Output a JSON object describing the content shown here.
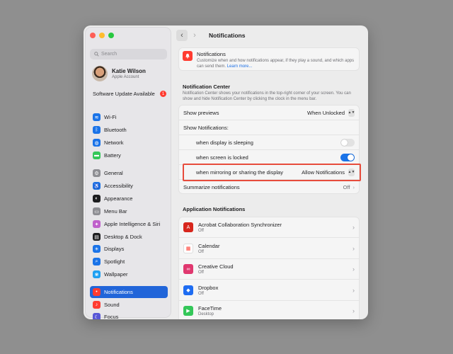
{
  "window": {
    "title": "Notifications"
  },
  "sidebar": {
    "search_placeholder": "Search",
    "account": {
      "name": "Katie Wilson",
      "subtitle": "Apple Account"
    },
    "update": {
      "label": "Software Update Available",
      "count": "1"
    },
    "items": [
      {
        "label": "Wi-Fi",
        "icon": "wifi-icon",
        "color": "#1a73e8"
      },
      {
        "label": "Bluetooth",
        "icon": "bluetooth-icon",
        "color": "#1a73e8"
      },
      {
        "label": "Network",
        "icon": "globe-icon",
        "color": "#1a73e8"
      },
      {
        "label": "Battery",
        "icon": "battery-icon",
        "color": "#34c759"
      },
      {
        "label": "General",
        "icon": "gear-icon",
        "color": "#8e8e93"
      },
      {
        "label": "Accessibility",
        "icon": "accessibility-icon",
        "color": "#1a73e8"
      },
      {
        "label": "Appearance",
        "icon": "appearance-icon",
        "color": "#1d1d1f"
      },
      {
        "label": "Menu Bar",
        "icon": "menubar-icon",
        "color": "#8e8e93"
      },
      {
        "label": "Apple Intelligence & Siri",
        "icon": "siri-icon",
        "color": "#c061cb"
      },
      {
        "label": "Desktop & Dock",
        "icon": "dock-icon",
        "color": "#1d1d1f"
      },
      {
        "label": "Displays",
        "icon": "display-icon",
        "color": "#1a73e8"
      },
      {
        "label": "Spotlight",
        "icon": "spotlight-icon",
        "color": "#1a73e8"
      },
      {
        "label": "Wallpaper",
        "icon": "wallpaper-icon",
        "color": "#1ea0f2"
      },
      {
        "label": "Notifications",
        "icon": "bell-icon",
        "color": "#ff3b30",
        "active": true
      },
      {
        "label": "Sound",
        "icon": "speaker-icon",
        "color": "#ff3b30"
      },
      {
        "label": "Focus",
        "icon": "moon-icon",
        "color": "#5856d6"
      }
    ]
  },
  "header": {
    "title": "Notifications",
    "description": "Customize when and how notifications appear, if they play a sound, and which apps can send them.",
    "link": "Learn more..."
  },
  "notification_center": {
    "title": "Notification Center",
    "description": "Notification Center shows your notifications in the top-right corner of your screen. You can show and hide Notification Center by clicking the clock in the menu bar.",
    "show_previews": {
      "label": "Show previews",
      "value": "When Unlocked"
    },
    "show_notifications": {
      "label": "Show Notifications:"
    },
    "display_sleeping": {
      "label": "when display is sleeping",
      "on": false
    },
    "screen_locked": {
      "label": "when screen is locked",
      "on": true
    },
    "mirroring": {
      "label": "when mirroring or sharing the display",
      "value": "Allow Notifications"
    },
    "summarize": {
      "label": "Summarize notifications",
      "value": "Off"
    }
  },
  "app_notifications": {
    "title": "Application Notifications",
    "apps": [
      {
        "name": "Acrobat Collaboration Synchronizer",
        "status": "Off",
        "icon": "acrobat-icon",
        "color": "#d7261c"
      },
      {
        "name": "Calendar",
        "status": "Off",
        "icon": "calendar-icon",
        "color": "#ffffff"
      },
      {
        "name": "Creative Cloud",
        "status": "Off",
        "icon": "creative-cloud-icon",
        "color": "#e0386f"
      },
      {
        "name": "Dropbox",
        "status": "Off",
        "icon": "dropbox-icon",
        "color": "#1f6df2"
      },
      {
        "name": "FaceTime",
        "status": "Desktop",
        "icon": "facetime-icon",
        "color": "#34c759"
      }
    ]
  }
}
